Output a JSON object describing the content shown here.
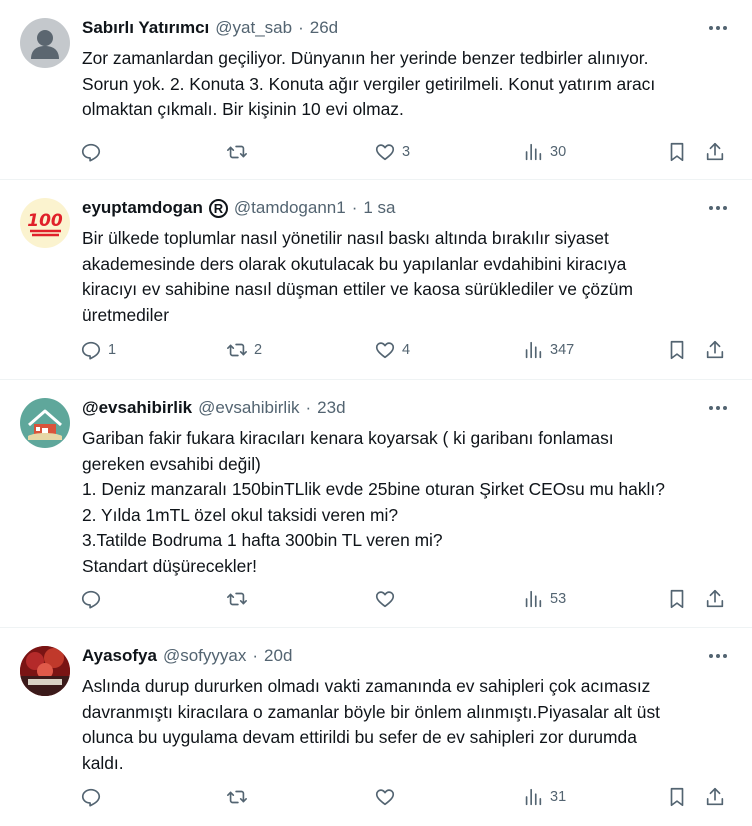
{
  "tweets": [
    {
      "name": "Sabırlı Yatırımcı",
      "handle": "@yat_sab",
      "time": "26d",
      "lines": [
        "Zor zamanlardan geçiliyor. Dünyanın her yerinde benzer tedbirler alınıyor.",
        "Sorun yok. 2. Konuta 3. Konuta ağır vergiler getirilmeli. Konut yatırım aracı",
        "olmaktan çıkmalı. Bir kişinin 10 evi olmaz."
      ],
      "replies": "",
      "retweets": "",
      "likes": "3",
      "views": "30",
      "avatar_icon": "default-user-avatar"
    },
    {
      "name": "eyuptamdogan",
      "name_badge": "R",
      "handle": "@tamdogann1",
      "time": "1 sa",
      "lines": [
        "Bir ülkede toplumlar nasıl yönetilir nasıl baskı altında bırakılır siyaset",
        "akademesinde ders olarak okutulacak bu yapılanlar evdahibini kiracıya",
        "kiracıyı ev sahibine nasıl düşman ettiler ve kaosa sürüklediler ve çözüm",
        "üretmediler"
      ],
      "replies": "1",
      "retweets": "2",
      "likes": "4",
      "views": "347",
      "avatar_icon": "hundred-emoji-avatar",
      "avatar_text": "100"
    },
    {
      "name": "@evsahibirlik",
      "handle": "@evsahibirlik",
      "time": "23d",
      "lines": [
        "Gariban fakir fukara kiracıları kenara koyarsak ( ki garibanı fonlaması",
        "gereken evsahibi değil)",
        "1. Deniz manzaralı 150binTLlik evde 25bine oturan Şirket CEOsu mu haklı?",
        "2. Yılda 1mTL özel okul taksidi veren mi?",
        "3.Tatilde Bodruma 1 hafta 300bin TL veren mi?",
        "Standart düşürecekler!"
      ],
      "replies": "",
      "retweets": "",
      "likes": "",
      "views": "53",
      "avatar_icon": "house-logo-avatar"
    },
    {
      "name": "Ayasofya",
      "handle": "@sofyyyax",
      "time": "20d",
      "lines": [
        "Aslında durup dururken olmadı vakti zamanında ev sahipleri çok acımasız",
        "davranmıştı kiracılara o zamanlar böyle bir önlem alınmıştı.Piyasalar alt üst",
        "olunca bu uygulama devam ettirildi bu sefer de ev sahipleri zor durumda",
        "kaldı."
      ],
      "replies": "",
      "retweets": "",
      "likes": "",
      "views": "31",
      "avatar_icon": "photo-avatar"
    }
  ],
  "colors": {
    "text": "#0f1419",
    "secondary": "#536471",
    "divider": "#eff3f4",
    "avatar_default": "#c4c8cc",
    "hundred_red": "#e0202a"
  }
}
